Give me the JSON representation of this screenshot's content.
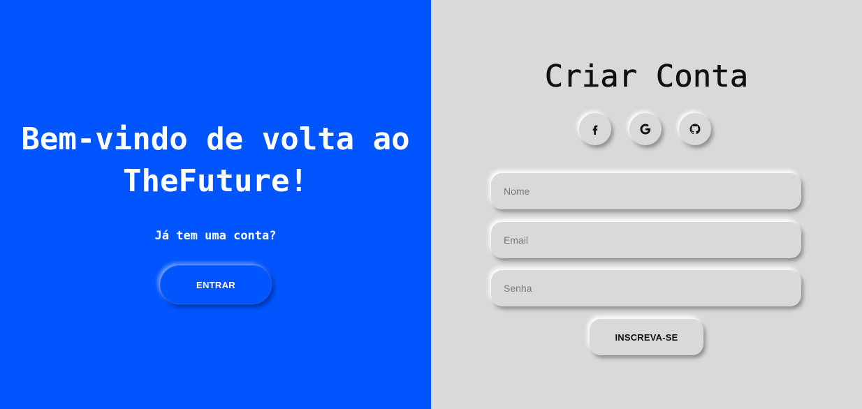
{
  "left": {
    "title": "Bem-vindo de volta ao TheFuture!",
    "subtitle": "Já tem uma conta?",
    "login_button": "ENTRAR",
    "background_color": "#0055ff"
  },
  "right": {
    "title": "Criar Conta",
    "social": [
      {
        "icon": "facebook-icon"
      },
      {
        "icon": "google-icon"
      },
      {
        "icon": "github-icon"
      }
    ],
    "fields": {
      "name": {
        "placeholder": "Nome",
        "value": ""
      },
      "email": {
        "placeholder": "Email",
        "value": ""
      },
      "password": {
        "placeholder": "Senha",
        "value": ""
      }
    },
    "signup_button": "INSCREVA-SE",
    "background_color": "#d9d9d9"
  }
}
